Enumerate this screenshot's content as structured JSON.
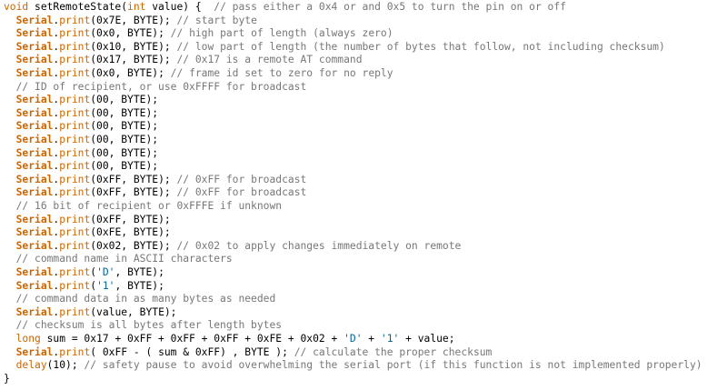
{
  "editor": {
    "language": "arduino",
    "colors": {
      "background": "#ffffff",
      "plain": "#000000",
      "comment": "#777777",
      "keyword": "#cc6600",
      "string": "#006699"
    },
    "lines": [
      {
        "indent": "",
        "tokens": [
          {
            "t": "void",
            "c": "keyword"
          },
          {
            "t": " setRemoteState(",
            "c": "plain"
          },
          {
            "t": "int",
            "c": "keyword"
          },
          {
            "t": " value) {  ",
            "c": "plain"
          },
          {
            "t": "// pass either a 0x4 or and 0x5 to turn the pin on or off",
            "c": "comment"
          }
        ]
      },
      {
        "indent": "  ",
        "tokens": [
          {
            "t": "Serial",
            "c": "keyword-bold"
          },
          {
            "t": ".",
            "c": "plain"
          },
          {
            "t": "print",
            "c": "keyword"
          },
          {
            "t": "(0x7E, BYTE); ",
            "c": "plain"
          },
          {
            "t": "// start byte",
            "c": "comment"
          }
        ]
      },
      {
        "indent": "  ",
        "tokens": [
          {
            "t": "Serial",
            "c": "keyword-bold"
          },
          {
            "t": ".",
            "c": "plain"
          },
          {
            "t": "print",
            "c": "keyword"
          },
          {
            "t": "(0x0, BYTE); ",
            "c": "plain"
          },
          {
            "t": "// high part of length (always zero)",
            "c": "comment"
          }
        ]
      },
      {
        "indent": "  ",
        "tokens": [
          {
            "t": "Serial",
            "c": "keyword-bold"
          },
          {
            "t": ".",
            "c": "plain"
          },
          {
            "t": "print",
            "c": "keyword"
          },
          {
            "t": "(0x10, BYTE); ",
            "c": "plain"
          },
          {
            "t": "// low part of length (the number of bytes that follow, not including checksum)",
            "c": "comment"
          }
        ]
      },
      {
        "indent": "  ",
        "tokens": [
          {
            "t": "Serial",
            "c": "keyword-bold"
          },
          {
            "t": ".",
            "c": "plain"
          },
          {
            "t": "print",
            "c": "keyword"
          },
          {
            "t": "(0x17, BYTE); ",
            "c": "plain"
          },
          {
            "t": "// 0x17 is a remote AT command",
            "c": "comment"
          }
        ]
      },
      {
        "indent": "  ",
        "tokens": [
          {
            "t": "Serial",
            "c": "keyword-bold"
          },
          {
            "t": ".",
            "c": "plain"
          },
          {
            "t": "print",
            "c": "keyword"
          },
          {
            "t": "(0x0, BYTE); ",
            "c": "plain"
          },
          {
            "t": "// frame id set to zero for no reply",
            "c": "comment"
          }
        ]
      },
      {
        "indent": "  ",
        "tokens": [
          {
            "t": "// ID of recipient, or use 0xFFFF for broadcast",
            "c": "comment"
          }
        ]
      },
      {
        "indent": "  ",
        "tokens": [
          {
            "t": "Serial",
            "c": "keyword-bold"
          },
          {
            "t": ".",
            "c": "plain"
          },
          {
            "t": "print",
            "c": "keyword"
          },
          {
            "t": "(00, BYTE);",
            "c": "plain"
          }
        ]
      },
      {
        "indent": "  ",
        "tokens": [
          {
            "t": "Serial",
            "c": "keyword-bold"
          },
          {
            "t": ".",
            "c": "plain"
          },
          {
            "t": "print",
            "c": "keyword"
          },
          {
            "t": "(00, BYTE);",
            "c": "plain"
          }
        ]
      },
      {
        "indent": "  ",
        "tokens": [
          {
            "t": "Serial",
            "c": "keyword-bold"
          },
          {
            "t": ".",
            "c": "plain"
          },
          {
            "t": "print",
            "c": "keyword"
          },
          {
            "t": "(00, BYTE);",
            "c": "plain"
          }
        ]
      },
      {
        "indent": "  ",
        "tokens": [
          {
            "t": "Serial",
            "c": "keyword-bold"
          },
          {
            "t": ".",
            "c": "plain"
          },
          {
            "t": "print",
            "c": "keyword"
          },
          {
            "t": "(00, BYTE);",
            "c": "plain"
          }
        ]
      },
      {
        "indent": "  ",
        "tokens": [
          {
            "t": "Serial",
            "c": "keyword-bold"
          },
          {
            "t": ".",
            "c": "plain"
          },
          {
            "t": "print",
            "c": "keyword"
          },
          {
            "t": "(00, BYTE);",
            "c": "plain"
          }
        ]
      },
      {
        "indent": "  ",
        "tokens": [
          {
            "t": "Serial",
            "c": "keyword-bold"
          },
          {
            "t": ".",
            "c": "plain"
          },
          {
            "t": "print",
            "c": "keyword"
          },
          {
            "t": "(00, BYTE);",
            "c": "plain"
          }
        ]
      },
      {
        "indent": "  ",
        "tokens": [
          {
            "t": "Serial",
            "c": "keyword-bold"
          },
          {
            "t": ".",
            "c": "plain"
          },
          {
            "t": "print",
            "c": "keyword"
          },
          {
            "t": "(0xFF, BYTE); ",
            "c": "plain"
          },
          {
            "t": "// 0xFF for broadcast",
            "c": "comment"
          }
        ]
      },
      {
        "indent": "  ",
        "tokens": [
          {
            "t": "Serial",
            "c": "keyword-bold"
          },
          {
            "t": ".",
            "c": "plain"
          },
          {
            "t": "print",
            "c": "keyword"
          },
          {
            "t": "(0xFF, BYTE); ",
            "c": "plain"
          },
          {
            "t": "// 0xFF for broadcast",
            "c": "comment"
          }
        ]
      },
      {
        "indent": "  ",
        "tokens": [
          {
            "t": "// 16 bit of recipient or 0xFFFE if unknown",
            "c": "comment"
          }
        ]
      },
      {
        "indent": "  ",
        "tokens": [
          {
            "t": "Serial",
            "c": "keyword-bold"
          },
          {
            "t": ".",
            "c": "plain"
          },
          {
            "t": "print",
            "c": "keyword"
          },
          {
            "t": "(0xFF, BYTE);",
            "c": "plain"
          }
        ]
      },
      {
        "indent": "  ",
        "tokens": [
          {
            "t": "Serial",
            "c": "keyword-bold"
          },
          {
            "t": ".",
            "c": "plain"
          },
          {
            "t": "print",
            "c": "keyword"
          },
          {
            "t": "(0xFE, BYTE);",
            "c": "plain"
          }
        ]
      },
      {
        "indent": "  ",
        "tokens": [
          {
            "t": "Serial",
            "c": "keyword-bold"
          },
          {
            "t": ".",
            "c": "plain"
          },
          {
            "t": "print",
            "c": "keyword"
          },
          {
            "t": "(0x02, BYTE); ",
            "c": "plain"
          },
          {
            "t": "// 0x02 to apply changes immediately on remote",
            "c": "comment"
          }
        ]
      },
      {
        "indent": "  ",
        "tokens": [
          {
            "t": "// command name in ASCII characters",
            "c": "comment"
          }
        ]
      },
      {
        "indent": "  ",
        "tokens": [
          {
            "t": "Serial",
            "c": "keyword-bold"
          },
          {
            "t": ".",
            "c": "plain"
          },
          {
            "t": "print",
            "c": "keyword"
          },
          {
            "t": "(",
            "c": "plain"
          },
          {
            "t": "'D'",
            "c": "string"
          },
          {
            "t": ", BYTE);",
            "c": "plain"
          }
        ]
      },
      {
        "indent": "  ",
        "tokens": [
          {
            "t": "Serial",
            "c": "keyword-bold"
          },
          {
            "t": ".",
            "c": "plain"
          },
          {
            "t": "print",
            "c": "keyword"
          },
          {
            "t": "(",
            "c": "plain"
          },
          {
            "t": "'1'",
            "c": "string"
          },
          {
            "t": ", BYTE);",
            "c": "plain"
          }
        ]
      },
      {
        "indent": "  ",
        "tokens": [
          {
            "t": "// command data in as many bytes as needed",
            "c": "comment"
          }
        ]
      },
      {
        "indent": "  ",
        "tokens": [
          {
            "t": "Serial",
            "c": "keyword-bold"
          },
          {
            "t": ".",
            "c": "plain"
          },
          {
            "t": "print",
            "c": "keyword"
          },
          {
            "t": "(value, BYTE);",
            "c": "plain"
          }
        ]
      },
      {
        "indent": "  ",
        "tokens": [
          {
            "t": "// checksum is all bytes after length bytes",
            "c": "comment"
          }
        ]
      },
      {
        "indent": "  ",
        "tokens": [
          {
            "t": "long",
            "c": "keyword"
          },
          {
            "t": " sum = 0x17 + 0xFF + 0xFF + 0xFF + 0xFE + 0x02 + ",
            "c": "plain"
          },
          {
            "t": "'D'",
            "c": "string"
          },
          {
            "t": " + ",
            "c": "plain"
          },
          {
            "t": "'1'",
            "c": "string"
          },
          {
            "t": " + value;",
            "c": "plain"
          }
        ]
      },
      {
        "indent": "  ",
        "tokens": [
          {
            "t": "Serial",
            "c": "keyword-bold"
          },
          {
            "t": ".",
            "c": "plain"
          },
          {
            "t": "print",
            "c": "keyword"
          },
          {
            "t": "( 0xFF - ( sum & 0xFF) , BYTE ); ",
            "c": "plain"
          },
          {
            "t": "// calculate the proper checksum",
            "c": "comment"
          }
        ]
      },
      {
        "indent": "  ",
        "tokens": [
          {
            "t": "delay",
            "c": "keyword"
          },
          {
            "t": "(10); ",
            "c": "plain"
          },
          {
            "t": "// safety pause to avoid overwhelming the serial port (if this function is not implemented properly)",
            "c": "comment"
          }
        ]
      },
      {
        "indent": "",
        "tokens": [
          {
            "t": "}",
            "c": "plain"
          }
        ]
      }
    ]
  }
}
